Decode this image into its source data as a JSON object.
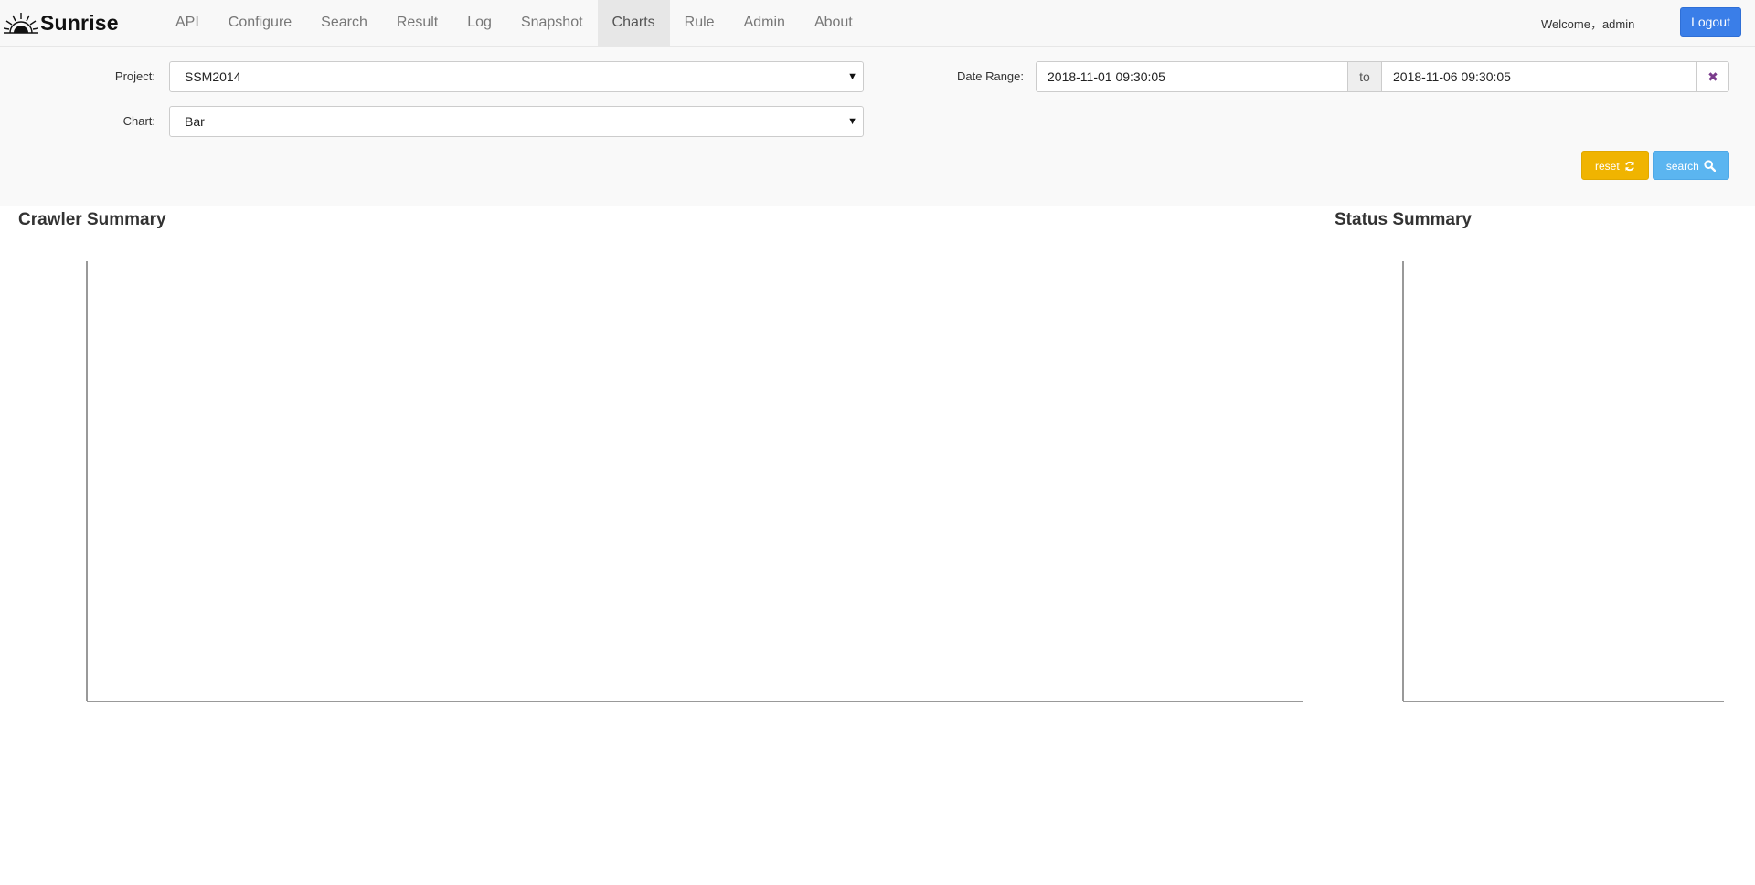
{
  "brand": {
    "name": "Sunrise",
    "logo_icon": "sunrise-logo-icon"
  },
  "nav": {
    "items": [
      {
        "label": "API",
        "active": false
      },
      {
        "label": "Configure",
        "active": false
      },
      {
        "label": "Search",
        "active": false
      },
      {
        "label": "Result",
        "active": false
      },
      {
        "label": "Log",
        "active": false
      },
      {
        "label": "Snapshot",
        "active": false
      },
      {
        "label": "Charts",
        "active": true
      },
      {
        "label": "Rule",
        "active": false
      },
      {
        "label": "Admin",
        "active": false
      },
      {
        "label": "About",
        "active": false
      }
    ],
    "welcome": "Welcome，admin",
    "logout_label": "Logout"
  },
  "form": {
    "project_label": "Project:",
    "project_value": "SSM2014",
    "chart_label": "Chart:",
    "chart_value": "Bar",
    "date_range_label": "Date Range:",
    "date_from": "2018-11-01 09:30:05",
    "date_to_separator": "to",
    "date_to": "2018-11-06 09:30:05",
    "clear_icon": "close-icon",
    "reset_label": "reset",
    "reset_icon": "refresh-icon",
    "search_label": "search",
    "search_icon": "search-icon"
  },
  "colors": {
    "logout": "#3a7ee8",
    "reset": "#f0b400",
    "search": "#5bb5f0"
  },
  "chart_data": [
    {
      "type": "bar",
      "title": "Crawler Summary",
      "categories": [],
      "series": []
    },
    {
      "type": "bar",
      "title": "Status Summary",
      "categories": [],
      "series": []
    }
  ]
}
